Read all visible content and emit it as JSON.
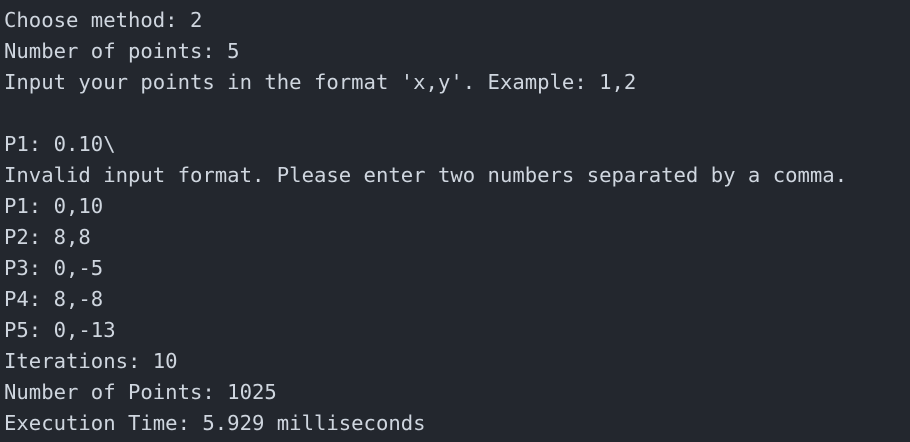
{
  "terminal": {
    "lines": [
      "Choose method: 2",
      "Number of points: 5",
      "Input your points in the format 'x,y'. Example: 1,2",
      "",
      "P1: 0.10\\",
      "Invalid input format. Please enter two numbers separated by a comma.",
      "P1: 0,10",
      "P2: 8,8",
      "P3: 0,-5",
      "P4: 8,-8",
      "P5: 0,-13",
      "Iterations: 10",
      "Number of Points: 1025",
      "Execution Time: 5.929 milliseconds"
    ]
  },
  "colors": {
    "background": "#23272e",
    "text": "#cfd6df"
  }
}
